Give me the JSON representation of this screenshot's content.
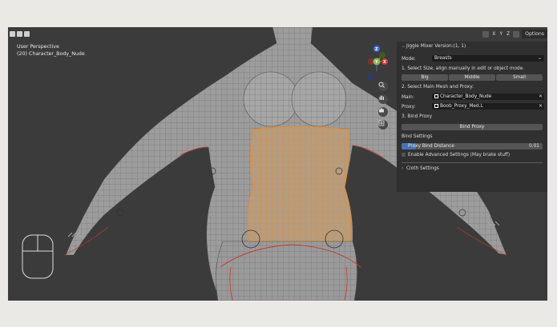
{
  "viewport": {
    "mode_label": "User Perspective",
    "object_label": "(20) Character_Body_Nude",
    "gizmo": {
      "x": "X",
      "y": "Y",
      "z": "Z"
    }
  },
  "header": {
    "axes": [
      "X",
      "Y",
      "Z"
    ],
    "options_label": "Options"
  },
  "panel": {
    "title": "Jiggle Mixer Version:(1, 1)",
    "mode_label": "Mode:",
    "mode_value": "Breasts",
    "step1": "1. Select Size, align manually in edit or object mode.",
    "size_buttons": [
      "Big",
      "Middle",
      "Small"
    ],
    "step2": "2. Select Main Mesh and Proxy:",
    "main_label": "Main:",
    "main_value": "Character_Body_Nude",
    "proxy_label": "Proxy:",
    "proxy_value": "Boob_Proxy_Med.L",
    "step3": "3. Bind Proxy",
    "bind_button": "Bind Proxy",
    "bind_settings": "Bind Settings",
    "slider_label": "Proxy Bind Distance",
    "slider_value": "0.01",
    "slider_fill": 0.05,
    "advanced_label": "Enable Advanced Settings (May brake stuff)",
    "cloth_label": "Cloth Settings"
  },
  "colors": {
    "accent_blue": "#4772b3",
    "selection_orange": "#e08a32",
    "seam_red": "#c83a2a",
    "mesh_grey": "#9c9c9c"
  }
}
